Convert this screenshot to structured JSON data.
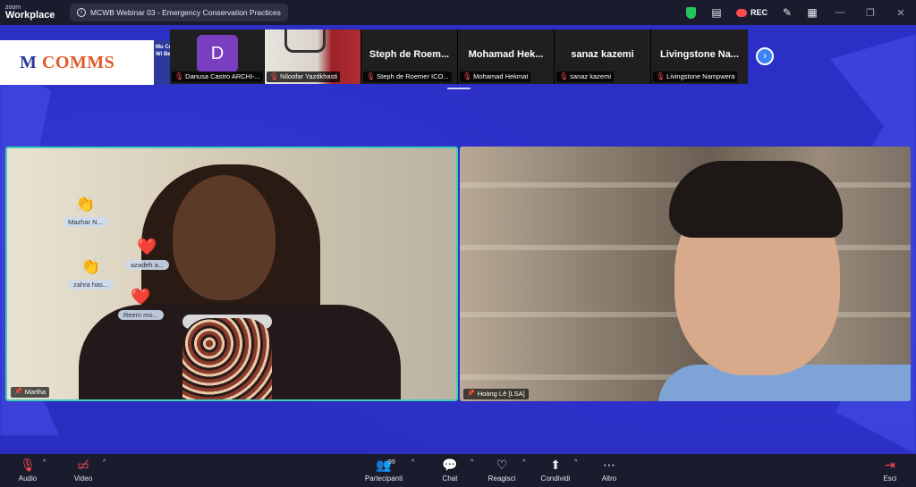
{
  "app": {
    "logo_line1": "zoom",
    "logo_line2": "Workplace"
  },
  "meeting": {
    "title": "MCWB Webinar 03 - Emergency Conservation Practices"
  },
  "titlebar": {
    "rec_label": "REC"
  },
  "banner": {
    "logo_text": "COMMS",
    "logo_mark": "M",
    "side_text": "Mu Con Wi Be"
  },
  "gallery": {
    "participants": [
      {
        "label": "Danusa Castro ARCHI-...",
        "display": "D",
        "kind": "avatar"
      },
      {
        "label": "Niloofar Yazdkhasti",
        "display": "",
        "kind": "video"
      },
      {
        "label": "Steph de Roemer ICO...",
        "display": "Steph de Roem...",
        "kind": "name"
      },
      {
        "label": "Mohamad Hekmat",
        "display": "Mohamad Hek...",
        "kind": "name"
      },
      {
        "label": "sanaz kazemi",
        "display": "sanaz kazemi",
        "kind": "name"
      },
      {
        "label": "Livingstone Nampwera",
        "display": "Livingstone Na...",
        "kind": "name"
      }
    ]
  },
  "videos": {
    "left": {
      "name": "Martha"
    },
    "right": {
      "name": "Hoàng Lê [LSA]"
    }
  },
  "reactions": [
    {
      "emoji": "👏",
      "name": "Mazhar N..."
    },
    {
      "emoji": "❤️",
      "name": "azadeh a..."
    },
    {
      "emoji": "👏",
      "name": "zahra has..."
    },
    {
      "emoji": "❤️",
      "name": "Reem mo..."
    }
  ],
  "toolbar": {
    "audio": "Audio",
    "video": "Video",
    "participants": "Partecipanti",
    "participants_count": "99",
    "chat": "Chat",
    "reactions": "Reagisci",
    "share": "Condividi",
    "more": "Altro",
    "leave": "Esci"
  },
  "colors": {
    "accent_border": "#3ed1b4",
    "background": "#2a2fc4",
    "toolbar": "#1a1c2e",
    "muted": "#ff4d4d"
  }
}
